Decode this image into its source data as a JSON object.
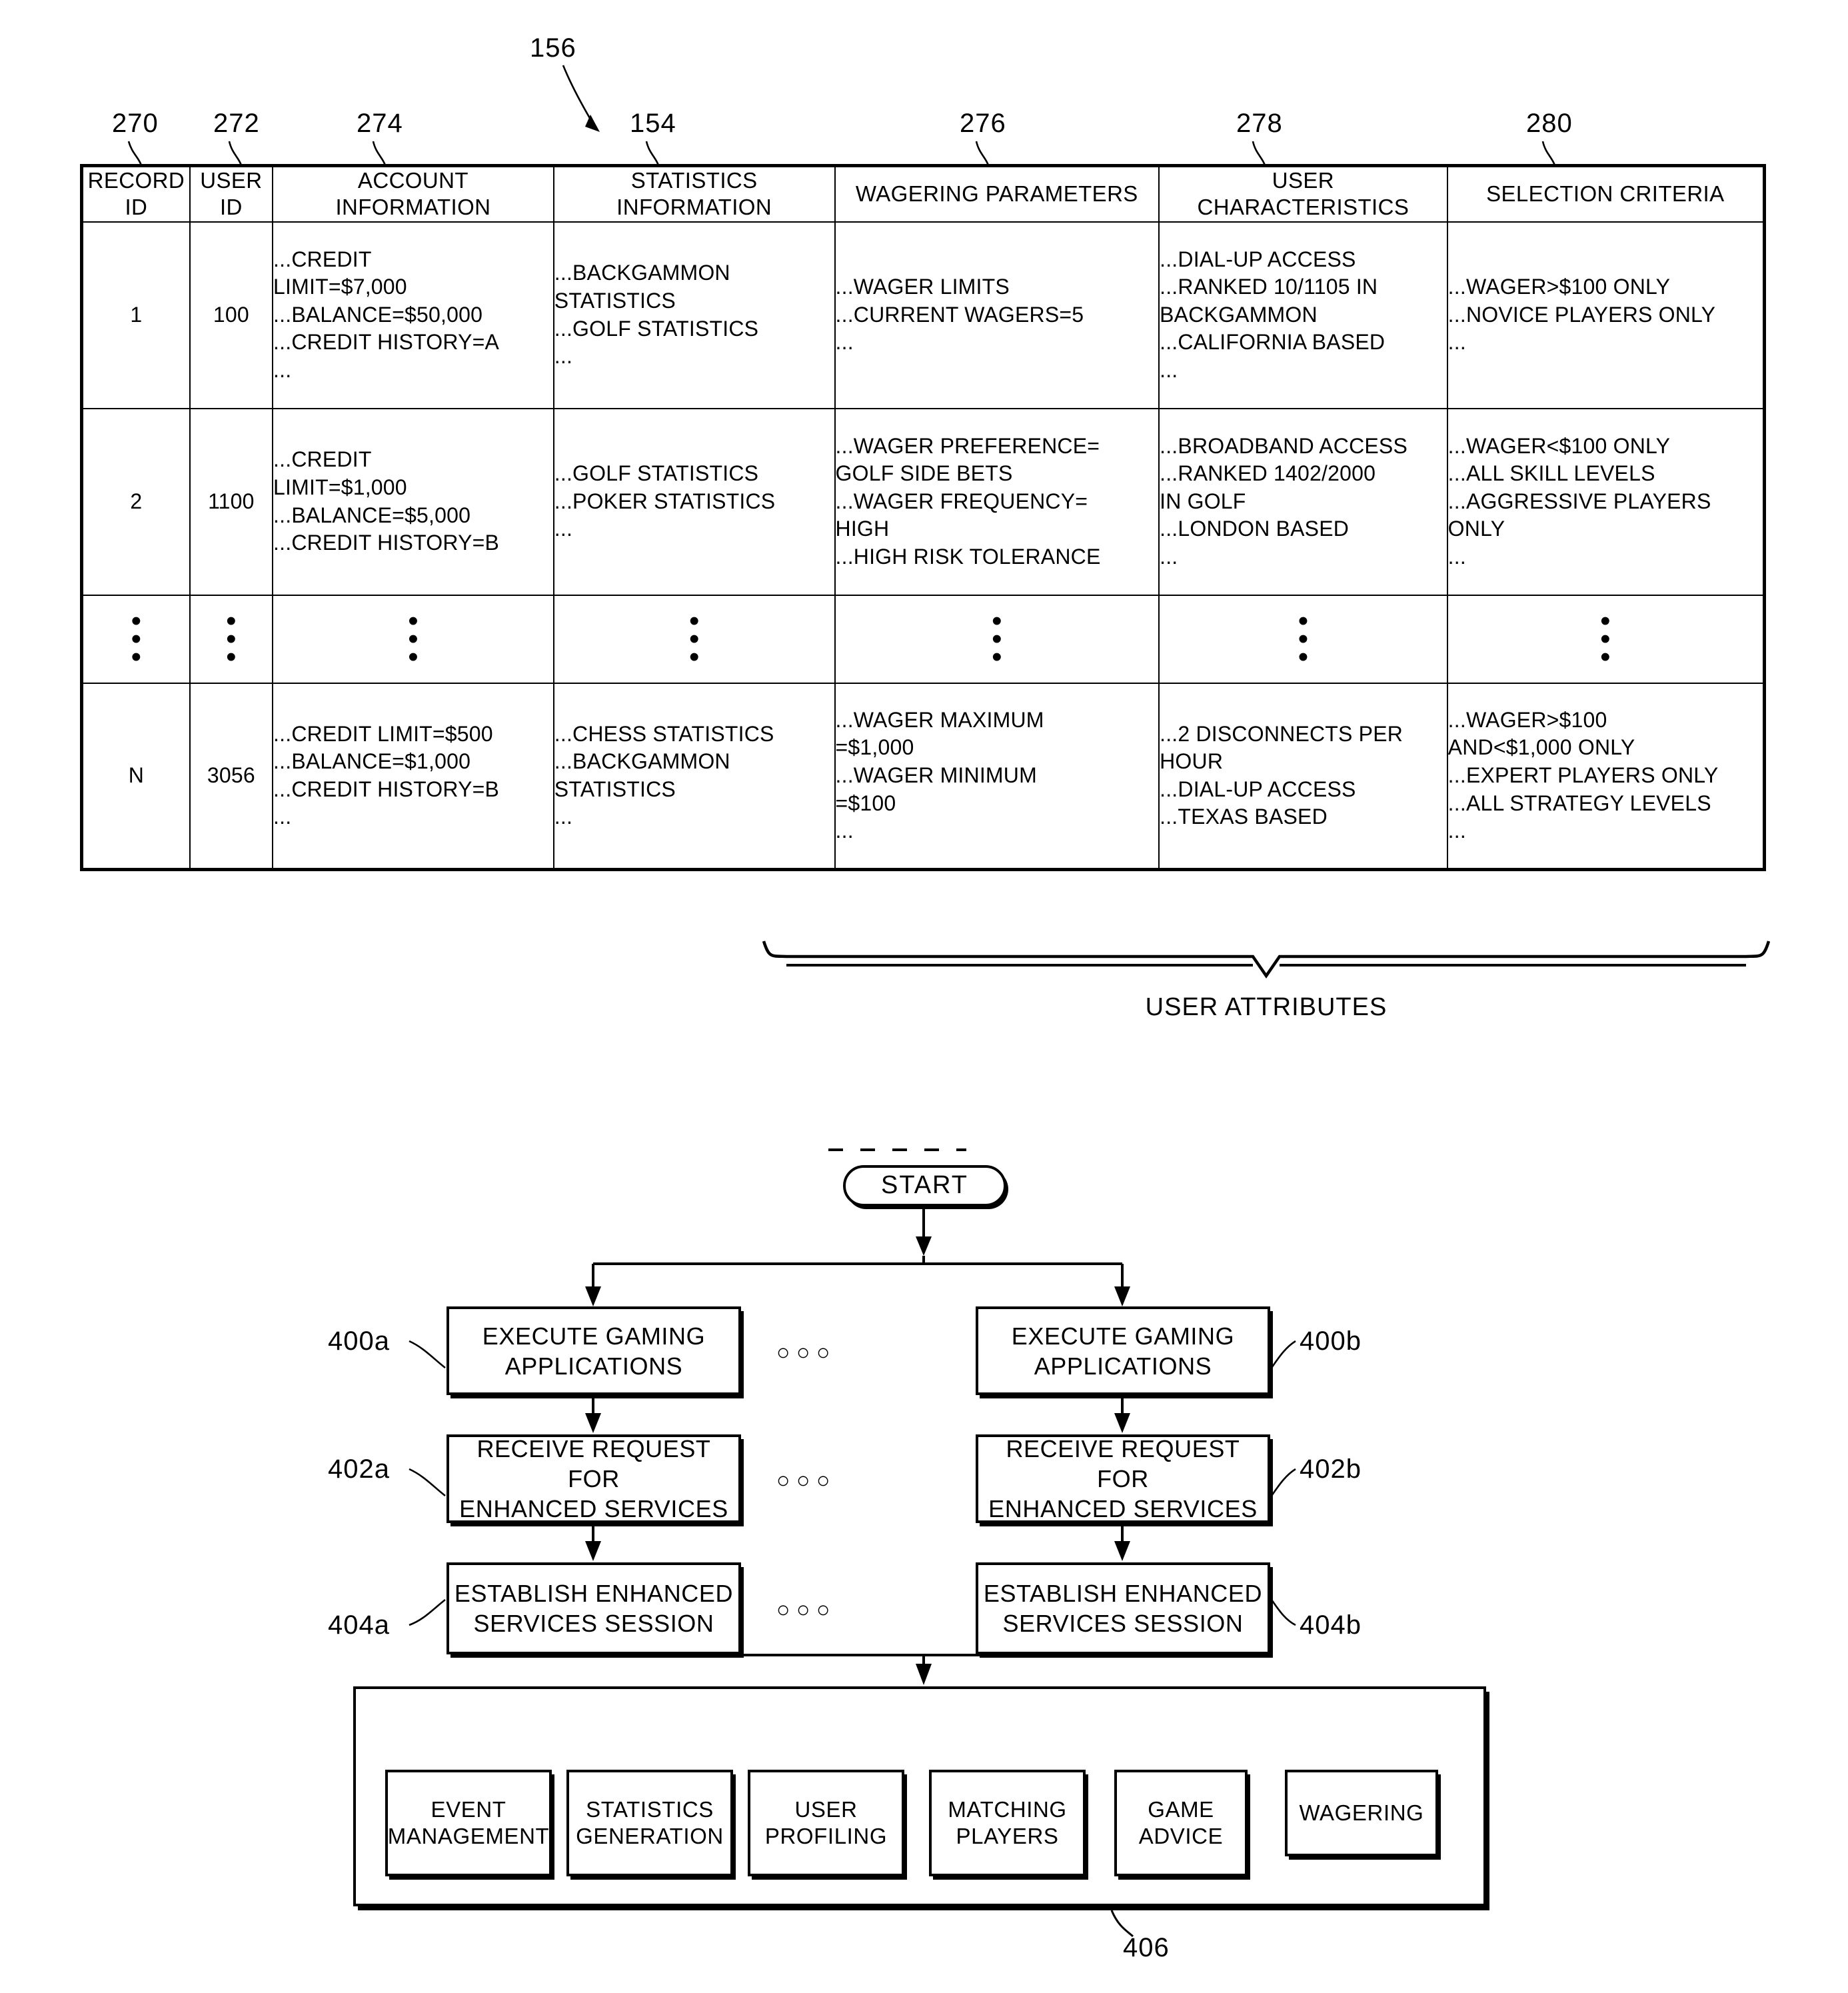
{
  "figure": {
    "table_ref": "156",
    "table_columns_refs": [
      "270",
      "272",
      "274",
      "154",
      "276",
      "278",
      "280"
    ],
    "user_attributes_label": "USER ATTRIBUTES"
  },
  "table": {
    "headers": [
      "RECORD\nID",
      "USER\nID",
      "ACCOUNT\nINFORMATION",
      "STATISTICS\nINFORMATION",
      "WAGERING PARAMETERS",
      "USER\nCHARACTERISTICS",
      "SELECTION CRITERIA"
    ],
    "rows": [
      {
        "record_id": "1",
        "user_id": "100",
        "account_information": [
          "...CREDIT",
          "LIMIT=$7,000",
          "...BALANCE=$50,000",
          "...CREDIT HISTORY=A",
          "..."
        ],
        "statistics_information": [
          "...BACKGAMMON",
          "STATISTICS",
          "...GOLF STATISTICS",
          "..."
        ],
        "wagering_parameters": [
          "...WAGER LIMITS",
          "...CURRENT WAGERS=5",
          "..."
        ],
        "user_characteristics": [
          "...DIAL-UP ACCESS",
          "...RANKED 10/1105 IN",
          "BACKGAMMON",
          "...CALIFORNIA BASED",
          "..."
        ],
        "selection_criteria": [
          "...WAGER>$100 ONLY",
          "...NOVICE PLAYERS ONLY",
          "..."
        ]
      },
      {
        "record_id": "2",
        "user_id": "1100",
        "account_information": [
          "...CREDIT",
          "LIMIT=$1,000",
          "...BALANCE=$5,000",
          "...CREDIT HISTORY=B"
        ],
        "statistics_information": [
          "...GOLF STATISTICS",
          "...POKER STATISTICS",
          "..."
        ],
        "wagering_parameters": [
          "...WAGER PREFERENCE=",
          "GOLF SIDE BETS",
          "...WAGER FREQUENCY=",
          "HIGH",
          "...HIGH RISK TOLERANCE"
        ],
        "user_characteristics": [
          "...BROADBAND ACCESS",
          "...RANKED 1402/2000",
          "IN GOLF",
          "...LONDON BASED",
          "..."
        ],
        "selection_criteria": [
          "...WAGER<$100 ONLY",
          "...ALL SKILL LEVELS",
          "...AGGRESSIVE PLAYERS",
          "ONLY",
          "..."
        ]
      },
      {
        "record_id": "N",
        "user_id": "3056",
        "account_information": [
          "...CREDIT LIMIT=$500",
          "...BALANCE=$1,000",
          "...CREDIT HISTORY=B",
          "..."
        ],
        "statistics_information": [
          "...CHESS STATISTICS",
          "...BACKGAMMON",
          "STATISTICS",
          "..."
        ],
        "wagering_parameters": [
          "...WAGER MAXIMUM",
          "=$1,000",
          "...WAGER MINIMUM",
          "=$100",
          "..."
        ],
        "user_characteristics": [
          "...2 DISCONNECTS PER",
          "HOUR",
          "...DIAL-UP ACCESS",
          "...TEXAS BASED"
        ],
        "selection_criteria": [
          "...WAGER>$100",
          "AND<$1,000 ONLY",
          "...EXPERT PLAYERS ONLY",
          "...ALL STRATEGY LEVELS",
          "..."
        ]
      }
    ],
    "ellipsis_glyph": "•"
  },
  "flowchart": {
    "start_label": "START",
    "branches": [
      {
        "ref_execute": "400a",
        "ref_receive": "402a",
        "ref_establish": "404a",
        "execute_label": "EXECUTE GAMING\nAPPLICATIONS",
        "receive_label": "RECEIVE REQUEST FOR\nENHANCED SERVICES",
        "establish_label": "ESTABLISH ENHANCED\nSERVICES SESSION"
      },
      {
        "ref_execute": "400b",
        "ref_receive": "402b",
        "ref_establish": "404b",
        "execute_label": "EXECUTE GAMING\nAPPLICATIONS",
        "receive_label": "RECEIVE REQUEST FOR\nENHANCED SERVICES",
        "establish_label": "ESTABLISH ENHANCED\nSERVICES SESSION"
      }
    ],
    "services_ref": "406",
    "services": [
      "EVENT\nMANAGEMENT",
      "STATISTICS\nGENERATION",
      "USER\nPROFILING",
      "MATCHING\nPLAYERS",
      "GAME\nADVICE",
      "WAGERING"
    ],
    "between_branch_dots": "○ ○ ○"
  },
  "colors": {
    "ink": "#000000",
    "paper": "#ffffff"
  }
}
